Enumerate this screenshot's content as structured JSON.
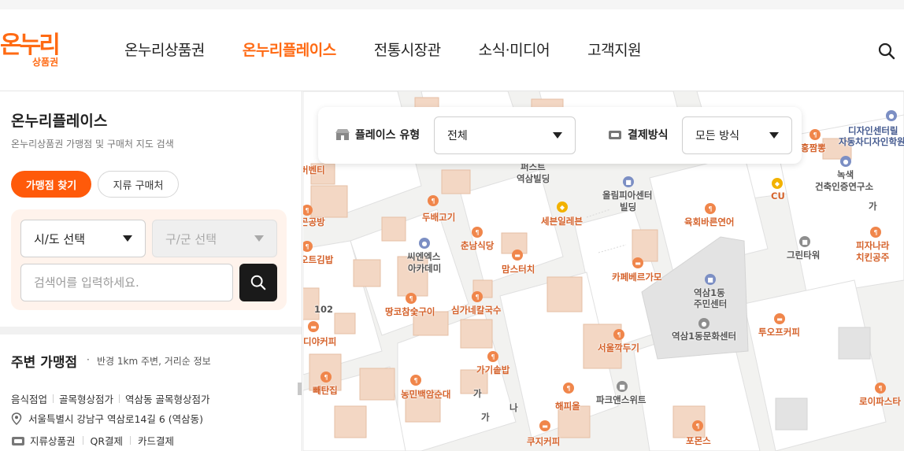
{
  "header": {
    "logo_main": "온누리",
    "logo_sub": "상품권",
    "nav": [
      {
        "label": "온누리상품권",
        "active": false
      },
      {
        "label": "온누리플레이스",
        "active": true
      },
      {
        "label": "전통시장관",
        "active": false
      },
      {
        "label": "소식·미디어",
        "active": false
      },
      {
        "label": "고객지원",
        "active": false
      }
    ],
    "search_icon": "search-icon"
  },
  "sidebar": {
    "title": "온누리플레이스",
    "description": "온누리상품권 가맹점 및 구매처 지도 검색",
    "tabs": [
      "가맹점 찾기",
      "지류 구매처"
    ],
    "sido_select": "시/도 선택",
    "gugun_select": "구/군 선택",
    "search_placeholder": "검색어를 입력하세요.",
    "nearby_title": "주변 가맹점",
    "nearby_dot": "·",
    "nearby_sub": "반경 1km 주변, 거리순 정보",
    "place": {
      "categories": [
        "음식점업",
        "골목형상점가",
        "역삼동 골목형상점가"
      ],
      "address": "서울특별시 강남구 역삼로14길 6 (역삼동)",
      "payments": [
        "지류상품권",
        "QR결제",
        "카드결제"
      ]
    }
  },
  "map_panel": {
    "place_type_label": "플레이스 유형",
    "place_type_value": "전체",
    "pay_method_label": "결제방식",
    "pay_method_value": "모든 방식"
  },
  "map_labels": {
    "l1": "퍼스트",
    "l2": "역삼빌딩",
    "l3": "올림피아센터",
    "l4": "빌딩",
    "l5": "세븐일레븐",
    "l6": "두배고기",
    "l7": "춘남식당",
    "l8": "씨엔엑스",
    "l9": "아카데미",
    "l10": "맘스터치",
    "l11": "육회바른연어",
    "l12": "카페베르가모",
    "l13": "역삼1동",
    "l14": "주민센터",
    "l15": "역삼1동문화센터",
    "l16": "땅코참숯구이",
    "l17": "심가네칼국수",
    "l18": "서울깍두기",
    "l19": "가기솥밥",
    "l20": "농민백암순대",
    "l21": "해피올",
    "l22": "파크앤스위트",
    "l23": "쿠지커피",
    "l24": "포몬스",
    "l25": "CU",
    "l26": "녹색",
    "l27": "건축인증연구소",
    "l28": "홍짬뽕",
    "l29": "디자인센터릴",
    "l30": "자동차디자인학원",
    "l31": "그린타워",
    "l32": "피자나라",
    "l33": "치킨공주",
    "l34": "투오프커피",
    "l35": "로이파스타",
    "l36": "버벤티",
    "l37": "곤공방",
    "l38": "오트김밥",
    "l39": "디야커피",
    "l40": "빼탄집",
    "l41": "102",
    "l42": "가",
    "l43": "나"
  },
  "colors": {
    "brand": "#ff6a13",
    "button_active": "#ff5a0a",
    "filter_bg": "#fff3ec",
    "search_button": "#1a1a1a"
  }
}
